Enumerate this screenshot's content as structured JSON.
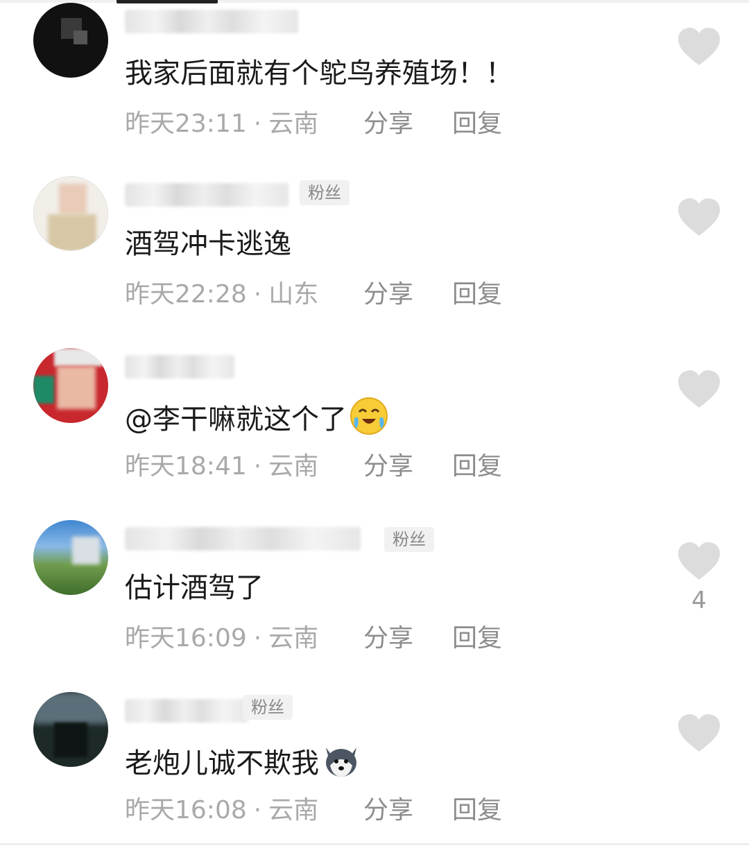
{
  "comments": [
    {
      "text": "我家后面就有个鸵鸟养殖场！！",
      "time": "昨天23:11",
      "location": "云南",
      "share_label": "分享",
      "reply_label": "回复",
      "fan_badge": "",
      "likes": "",
      "emoji": ""
    },
    {
      "text": "酒驾冲卡逃逸",
      "time": "昨天22:28",
      "location": "山东",
      "share_label": "分享",
      "reply_label": "回复",
      "fan_badge": "粉丝",
      "likes": "",
      "emoji": ""
    },
    {
      "text": "@李干嘛就这个了",
      "time": "昨天18:41",
      "location": "云南",
      "share_label": "分享",
      "reply_label": "回复",
      "fan_badge": "",
      "likes": "",
      "emoji": "crying-laughing-emoji"
    },
    {
      "text": "估计酒驾了",
      "time": "昨天16:09",
      "location": "云南",
      "share_label": "分享",
      "reply_label": "回复",
      "fan_badge": "粉丝",
      "likes": "4",
      "emoji": ""
    },
    {
      "text": "老炮儿诚不欺我",
      "time": "昨天16:08",
      "location": "云南",
      "share_label": "分享",
      "reply_label": "回复",
      "fan_badge": "粉丝",
      "likes": "",
      "emoji": "husky-dog-emoji"
    }
  ],
  "icons": {
    "like": "heart-icon",
    "separator": "·"
  },
  "colors": {
    "like_icon": "#dcdcdc",
    "meta_text": "#a9a9a9",
    "content_text": "#1a1a1a",
    "badge_bg": "#f1f1f1"
  }
}
